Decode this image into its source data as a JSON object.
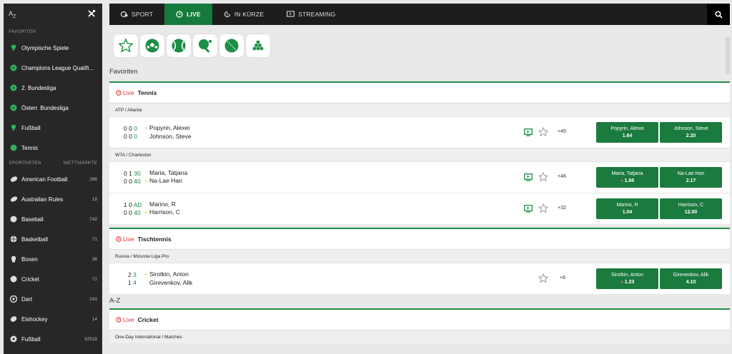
{
  "sidebar": {
    "favorites_heading": "FAVORITEN",
    "favorites": [
      {
        "label": "Olympische Spiele",
        "icon": "trophy-icon"
      },
      {
        "label": "Champions League Qualifi...",
        "icon": "soccer-ball-icon"
      },
      {
        "label": "2. Bundesliga",
        "icon": "soccer-ball-icon"
      },
      {
        "label": "Österr. Bundesliga",
        "icon": "soccer-ball-icon"
      },
      {
        "label": "Fußball",
        "icon": "trophy-icon"
      },
      {
        "label": "Tennis",
        "icon": "tennis-ball-icon"
      }
    ],
    "sports_heading": "SPORTARTEN",
    "markets_heading": "WETTMÄRKTE",
    "sports": [
      {
        "label": "American Football",
        "count": "286",
        "icon": "american-football-icon"
      },
      {
        "label": "Australian Rules",
        "count": "18",
        "icon": "rugby-ball-icon"
      },
      {
        "label": "Baseball",
        "count": "742",
        "icon": "baseball-icon"
      },
      {
        "label": "Basketball",
        "count": "71",
        "icon": "basketball-icon"
      },
      {
        "label": "Boxen",
        "count": "38",
        "icon": "boxing-glove-icon"
      },
      {
        "label": "Cricket",
        "count": "72",
        "icon": "cricket-ball-icon"
      },
      {
        "label": "Dart",
        "count": "241",
        "icon": "dartboard-icon"
      },
      {
        "label": "Eishockey",
        "count": "14",
        "icon": "ice-hockey-icon"
      },
      {
        "label": "Fußball",
        "count": "32518",
        "icon": "soccer-ball-icon"
      }
    ]
  },
  "nav": {
    "tabs": [
      {
        "label": "SPORT",
        "icon": "sport-icon",
        "active": false
      },
      {
        "label": "LIVE",
        "icon": "clock-icon",
        "active": true
      },
      {
        "label": "IN KÜRZE",
        "icon": "timer-icon",
        "active": false
      },
      {
        "label": "STREAMING",
        "icon": "tv-icon",
        "active": false
      }
    ]
  },
  "sport_filters": [
    "star-icon",
    "soccer-ball-icon",
    "tennis-ball-icon",
    "table-tennis-icon",
    "cricket-ball-icon",
    "snooker-icon"
  ],
  "sections": {
    "favorites_title": "Favoriten",
    "az_title": "A-Z"
  },
  "live_label": "Live",
  "tennis": {
    "sport": "Tennis",
    "league1": "ATP / Atlanta",
    "m1": {
      "s1": [
        "0",
        "0",
        "0"
      ],
      "s2": [
        "0",
        "0",
        "0"
      ],
      "p1": "Popyrin, Alexei",
      "p2": "Johnson, Steve",
      "more": "+45",
      "o1n": "Popyrin, Alexei",
      "o1v": "1.64",
      "o2n": "Johnson, Steve",
      "o2v": "2.20"
    },
    "league2": "WTA / Charleston",
    "m2": {
      "s1": [
        "0",
        "1",
        "30"
      ],
      "s2": [
        "0",
        "0",
        "40"
      ],
      "p1": "Maria, Tatjana",
      "p2": "Na-Lae Han",
      "more": "+46",
      "o1n": "Maria, Tatjana",
      "o1v": "1.66",
      "o2n": "Na-Lae Han",
      "o2v": "2.17"
    },
    "m3": {
      "s1": [
        "1",
        "0",
        "AD"
      ],
      "s2": [
        "0",
        "0",
        "40"
      ],
      "p1": "Marino, R",
      "p2": "Harrison, C",
      "more": "+32",
      "o1n": "Marino, R",
      "o1v": "1.04",
      "o2n": "Harrison, C",
      "o2v": "12.00"
    }
  },
  "tabletennis": {
    "sport": "Tischtennis",
    "league": "Russia / Moscow Liga Pro",
    "m1": {
      "s1": [
        "2",
        "3"
      ],
      "s2": [
        "1",
        "4"
      ],
      "p1": "Sirotkin, Anton",
      "p2": "Girevenkov, Alik",
      "more": "+6",
      "o1n": "Sirotkin, Anton",
      "o1v": "1.23",
      "o2n": "Girevenkov, Alik",
      "o2v": "4.10"
    }
  },
  "cricket": {
    "sport": "Cricket",
    "league": "One-Day International / Matches"
  },
  "colors": {
    "accent": "#157a3b",
    "live": "#e02b2b",
    "serve_dot": "#f0b400"
  }
}
